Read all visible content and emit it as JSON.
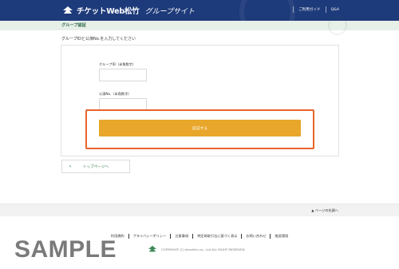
{
  "header": {
    "brand": "チケットWeb松竹",
    "site_name": "グループサイト",
    "nav": [
      {
        "label": "ご利用ガイド"
      },
      {
        "label": "Q&A"
      }
    ]
  },
  "section_title": "グループ認証",
  "instruction": "グループIDと公演No.を入力してください",
  "form": {
    "group_id_label": "グループID（半角数字）",
    "group_id_value": "",
    "performance_no_label": "公演No.（半角数字）",
    "performance_no_value": "",
    "submit_label": "認証する"
  },
  "back_link": "トップページへ",
  "page_top": "▲ ページの先頭へ",
  "footer": {
    "links": [
      "利用規約",
      "プライバシーポリシー",
      "注意事項",
      "特定商取引法に基づく表示",
      "お問い合わせ",
      "推奨環境"
    ],
    "copyright": "COPYRIGHT (C) shochiku co., Ltd ALL RIGHT RESERVED."
  },
  "watermark": "SAMPLE",
  "colors": {
    "header_bg": "#1d3a7a",
    "accent_green": "#2f6b45",
    "button_orange": "#e8a62a",
    "highlight_border": "#e8652a"
  }
}
